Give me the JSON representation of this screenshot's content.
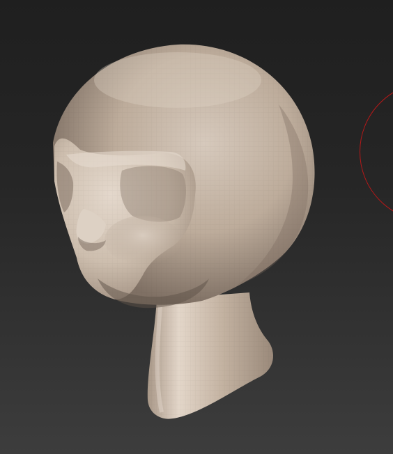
{
  "viewport": {
    "background_top": "#1f1f1f",
    "background_bottom": "#3d3d3d"
  },
  "model": {
    "subject": "sculpted-head-bust",
    "material_color": "#c2b2a2",
    "shadow_color": "#6e6156",
    "highlight_color": "#e8dcd0"
  },
  "brush_cursor": {
    "color": "#b81818",
    "icon": "brush-circle-icon"
  }
}
